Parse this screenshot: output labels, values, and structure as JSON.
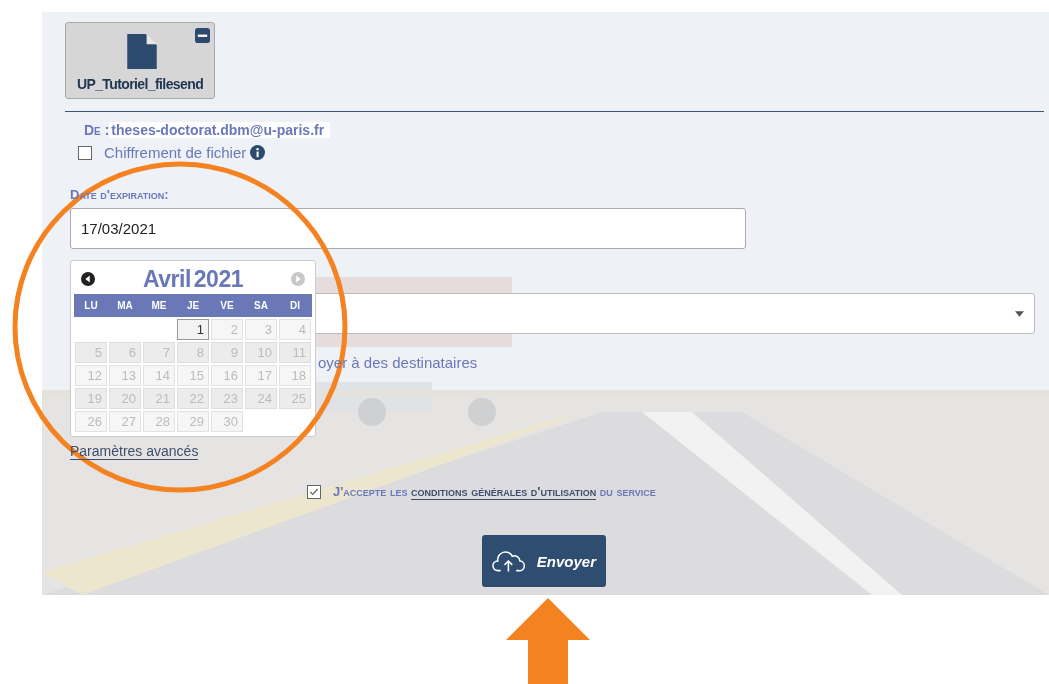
{
  "attachment": {
    "file_name": "UP_Tutoriel_filesend"
  },
  "from": {
    "label": "De :",
    "value": "theses-doctorat.dbm@u-paris.fr"
  },
  "encryption": {
    "label": "Chiffrement de fichier",
    "checked": false
  },
  "expiration": {
    "label": "Date d'expiration:",
    "value": "17/03/2021"
  },
  "datepicker": {
    "month": "Avril",
    "year": "2021",
    "weekdays": [
      "LU",
      "MA",
      "ME",
      "JE",
      "VE",
      "SA",
      "DI"
    ],
    "weeks": [
      [
        {
          "day": "1",
          "disabled": false
        },
        {
          "day": "2",
          "disabled": true
        },
        {
          "day": "3",
          "disabled": true
        },
        {
          "day": "4",
          "disabled": true
        }
      ],
      [
        {
          "day": "5",
          "disabled": true
        },
        {
          "day": "6",
          "disabled": true
        },
        {
          "day": "7",
          "disabled": true
        },
        {
          "day": "8",
          "disabled": true
        },
        {
          "day": "9",
          "disabled": true
        },
        {
          "day": "10",
          "disabled": true
        },
        {
          "day": "11",
          "disabled": true
        }
      ],
      [
        {
          "day": "12",
          "disabled": true
        },
        {
          "day": "13",
          "disabled": true
        },
        {
          "day": "14",
          "disabled": true
        },
        {
          "day": "15",
          "disabled": true
        },
        {
          "day": "16",
          "disabled": true
        },
        {
          "day": "17",
          "disabled": true
        },
        {
          "day": "18",
          "disabled": true
        }
      ],
      [
        {
          "day": "19",
          "disabled": true
        },
        {
          "day": "20",
          "disabled": true
        },
        {
          "day": "21",
          "disabled": true
        },
        {
          "day": "22",
          "disabled": true
        },
        {
          "day": "23",
          "disabled": true
        },
        {
          "day": "24",
          "disabled": true
        },
        {
          "day": "25",
          "disabled": true
        }
      ],
      [
        {
          "day": "26",
          "disabled": true
        },
        {
          "day": "27",
          "disabled": true
        },
        {
          "day": "28",
          "disabled": true
        },
        {
          "day": "29",
          "disabled": true
        },
        {
          "day": "30",
          "disabled": true
        }
      ]
    ],
    "next_disabled": true
  },
  "recipient_select": {
    "expanded": false
  },
  "send_to_recipients": {
    "label": "oyer à des destinataires"
  },
  "advanced": {
    "label": "Paramètres avancés"
  },
  "terms": {
    "checked": true,
    "before": "J'accepte les",
    "link": "conditions générales d'utilisation",
    "after": "du service"
  },
  "submit": {
    "label": "Envoyer"
  }
}
